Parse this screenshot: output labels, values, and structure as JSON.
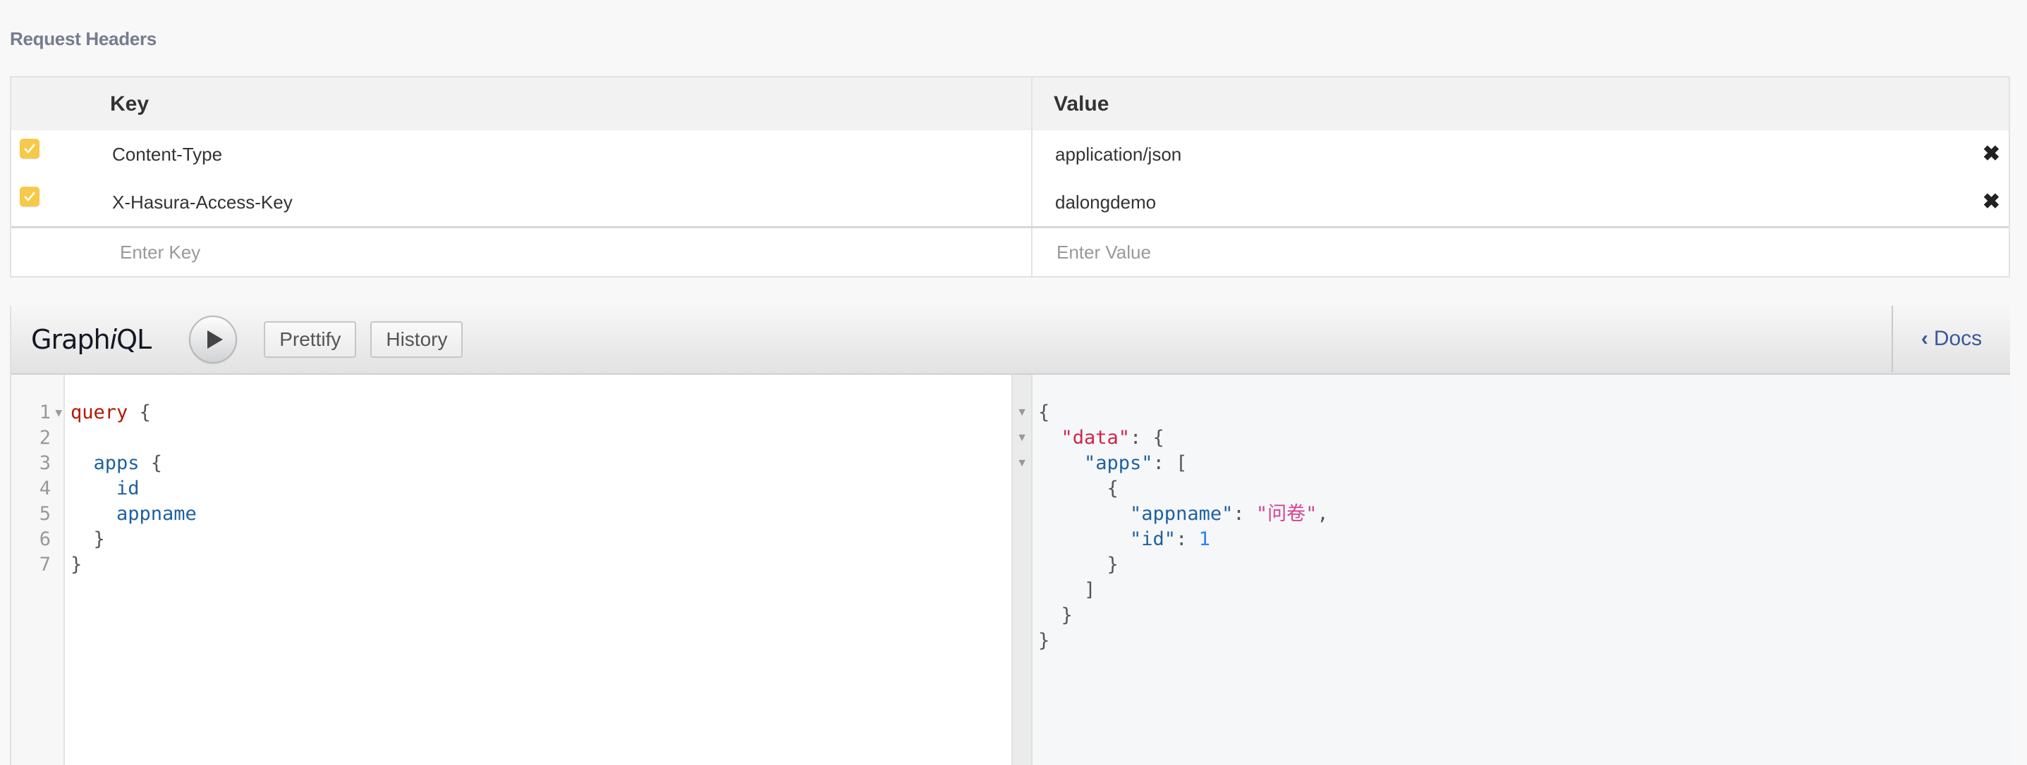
{
  "request_headers": {
    "title": "Request Headers",
    "columns": {
      "key": "Key",
      "value": "Value"
    },
    "rows": [
      {
        "enabled": true,
        "key": "Content-Type",
        "value": "application/json"
      },
      {
        "enabled": true,
        "key": "X-Hasura-Access-Key",
        "value": "dalongdemo"
      }
    ],
    "new_row": {
      "key_placeholder": "Enter Key",
      "value_placeholder": "Enter Value"
    },
    "remove_icon": "✖"
  },
  "graphiql": {
    "title_prefix": "Graph",
    "title_italic": "i",
    "title_suffix": "QL",
    "execute_icon": "play-icon",
    "prettify_label": "Prettify",
    "history_label": "History",
    "docs_label": "Docs",
    "docs_icon": "‹",
    "query_line_numbers": [
      "1",
      "2",
      "3",
      "4",
      "5",
      "6",
      "7"
    ],
    "query_lines": [
      [
        {
          "t": "query",
          "c": "kw"
        },
        {
          "t": " {",
          "c": "punct"
        }
      ],
      [],
      [
        {
          "t": "  apps",
          "c": "fld"
        },
        {
          "t": " {",
          "c": "punct"
        }
      ],
      [
        {
          "t": "    id",
          "c": "fld"
        }
      ],
      [
        {
          "t": "    appname",
          "c": "fld"
        }
      ],
      [
        {
          "t": "  }",
          "c": "punct"
        }
      ],
      [
        {
          "t": "}",
          "c": "punct"
        }
      ]
    ],
    "result_lines": [
      [
        {
          "t": "{",
          "c": "punct"
        }
      ],
      [
        {
          "t": "  \"data\"",
          "c": "jdata"
        },
        {
          "t": ": {",
          "c": "punct"
        }
      ],
      [
        {
          "t": "    \"apps\"",
          "c": "jkey"
        },
        {
          "t": ": [",
          "c": "punct"
        }
      ],
      [
        {
          "t": "      {",
          "c": "punct"
        }
      ],
      [
        {
          "t": "        \"appname\"",
          "c": "jkey"
        },
        {
          "t": ": ",
          "c": "punct"
        },
        {
          "t": "\"问卷\"",
          "c": "jstr"
        },
        {
          "t": ",",
          "c": "punct"
        }
      ],
      [
        {
          "t": "        \"id\"",
          "c": "jkey"
        },
        {
          "t": ": ",
          "c": "punct"
        },
        {
          "t": "1",
          "c": "jnum"
        }
      ],
      [
        {
          "t": "      }",
          "c": "punct"
        }
      ],
      [
        {
          "t": "    ]",
          "c": "punct"
        }
      ],
      [
        {
          "t": "  }",
          "c": "punct"
        }
      ],
      [
        {
          "t": "}",
          "c": "punct"
        }
      ]
    ],
    "fold_marker": "▼"
  }
}
